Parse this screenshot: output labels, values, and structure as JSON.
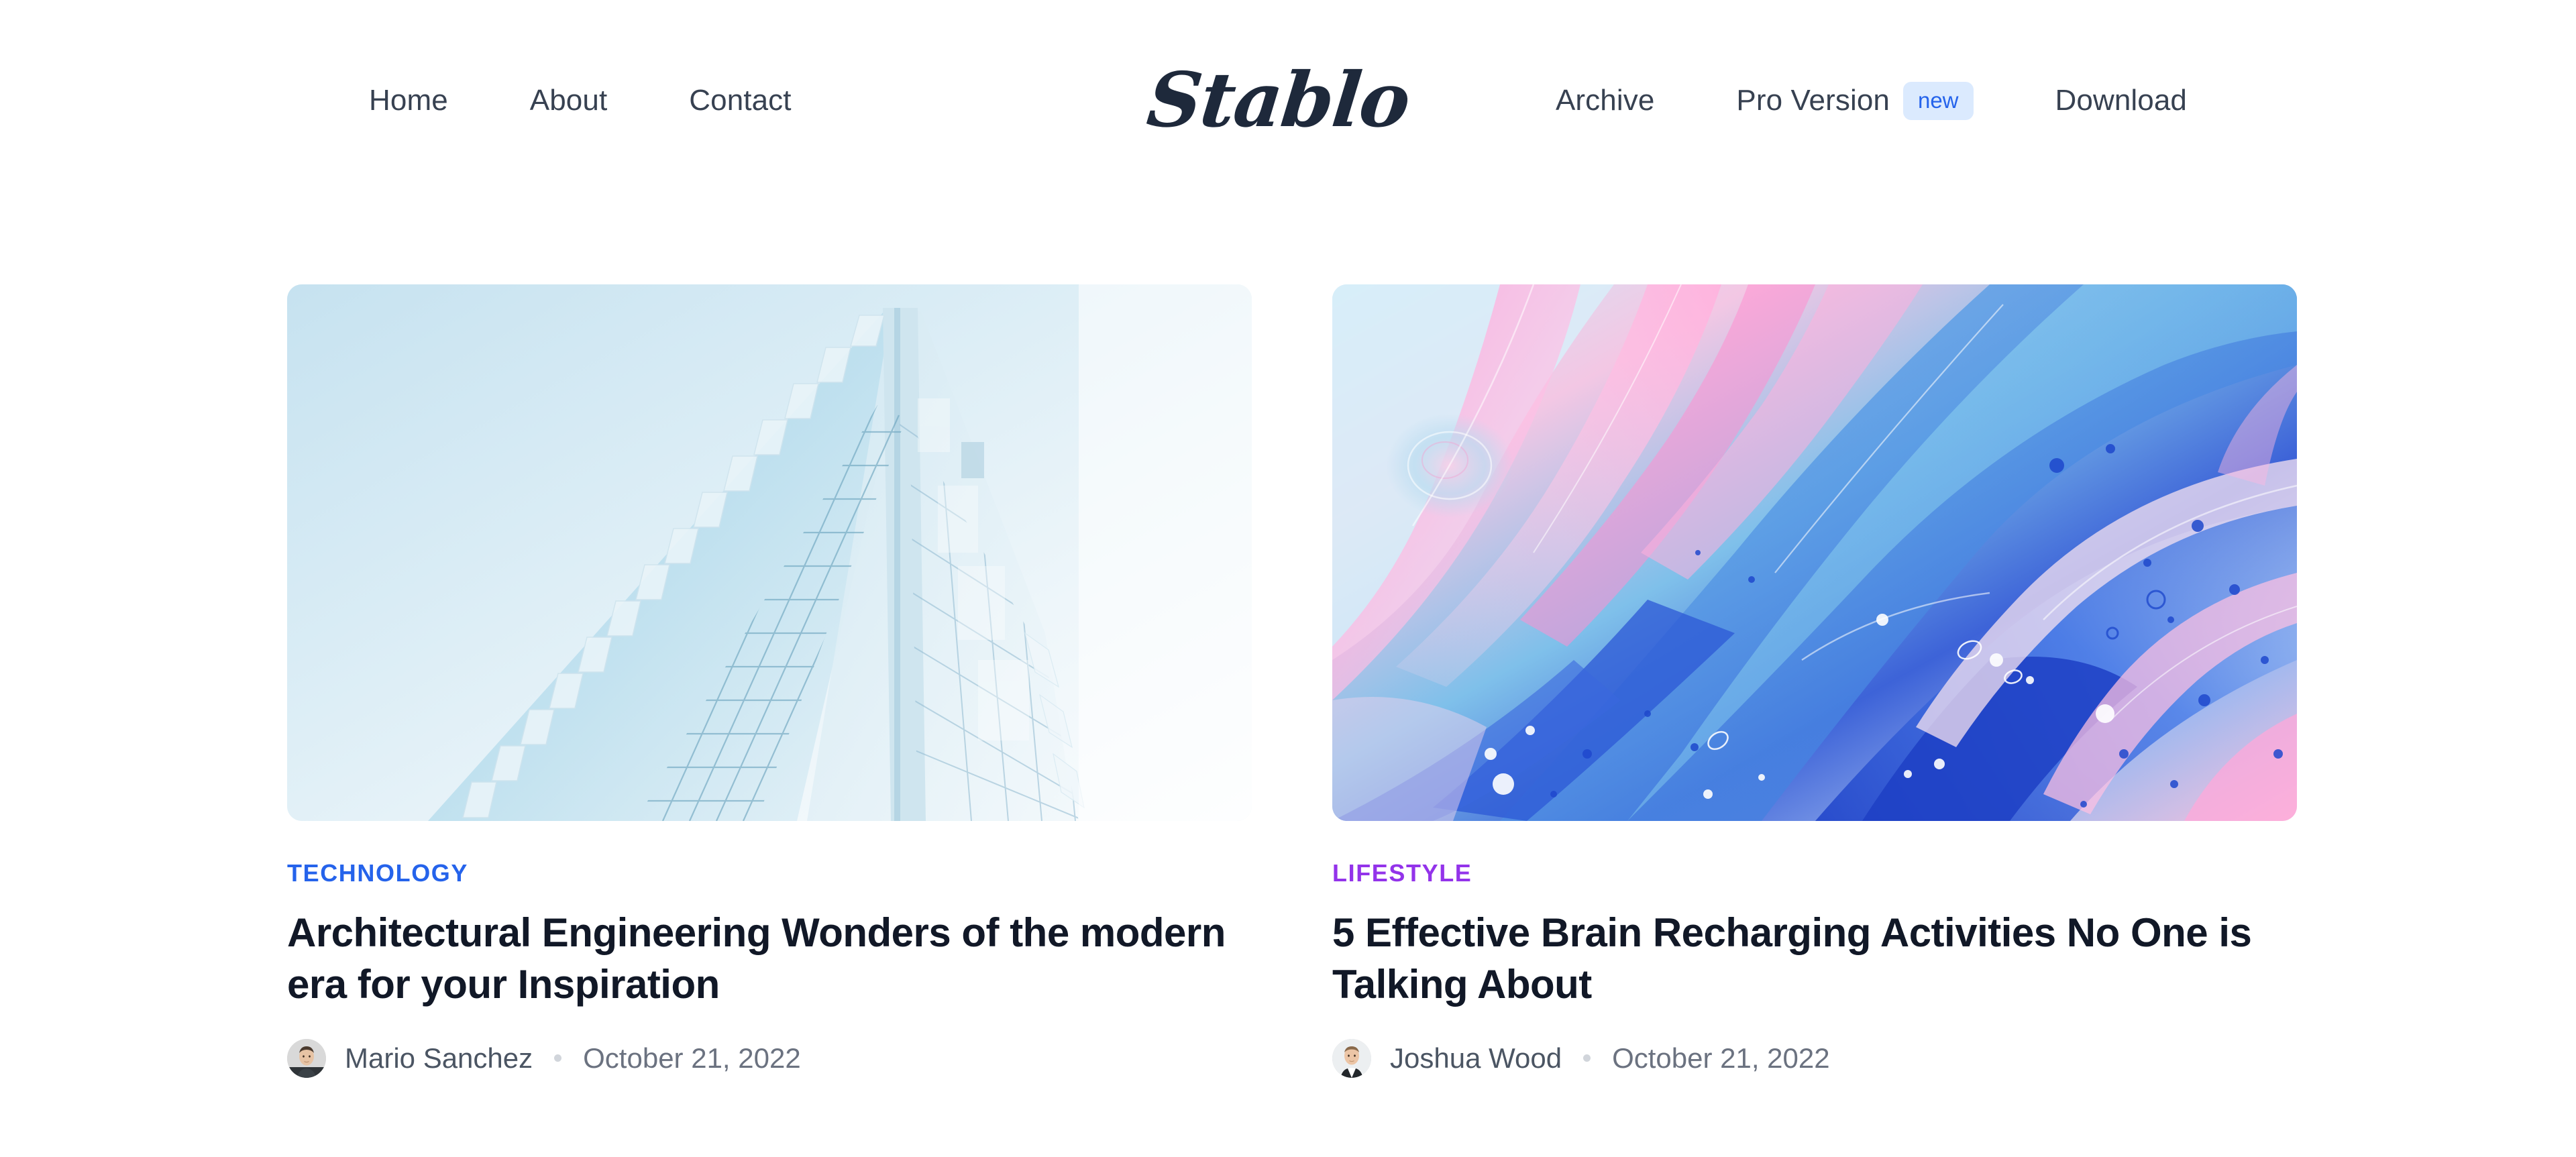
{
  "site": {
    "logo_text": "Stablo"
  },
  "header": {
    "nav_left": [
      {
        "label": "Home",
        "name": "nav-link-home"
      },
      {
        "label": "About",
        "name": "nav-link-about"
      },
      {
        "label": "Contact",
        "name": "nav-link-contact"
      }
    ],
    "nav_right": [
      {
        "label": "Archive",
        "name": "nav-link-archive"
      },
      {
        "label": "Pro Version",
        "name": "nav-link-pro-version",
        "badge": "new"
      },
      {
        "label": "Download",
        "name": "nav-link-download"
      }
    ],
    "badge_new_label": "new"
  },
  "colors": {
    "nav_text": "#374151",
    "logo": "#1e293b",
    "badge_bg": "#dbeafe",
    "badge_text": "#2563eb",
    "category_technology": "#2563eb",
    "category_lifestyle": "#9333ea",
    "title": "#111827",
    "author": "#4b5563",
    "date": "#6b7280",
    "page_bg": "#ffffff"
  },
  "posts": [
    {
      "category": "TECHNOLOGY",
      "title": "Architectural Engineering Wonders of the modern era for your Inspiration",
      "author": "Mario Sanchez",
      "date": "October 21, 2022",
      "image_alt": "glass-skyscraper-facade-photo"
    },
    {
      "category": "LIFESTYLE",
      "title": "5 Effective Brain Recharging Activities No One is Talking About",
      "author": "Joshua Wood",
      "date": "October 21, 2022",
      "image_alt": "abstract-pink-blue-fluid-art-photo"
    }
  ]
}
